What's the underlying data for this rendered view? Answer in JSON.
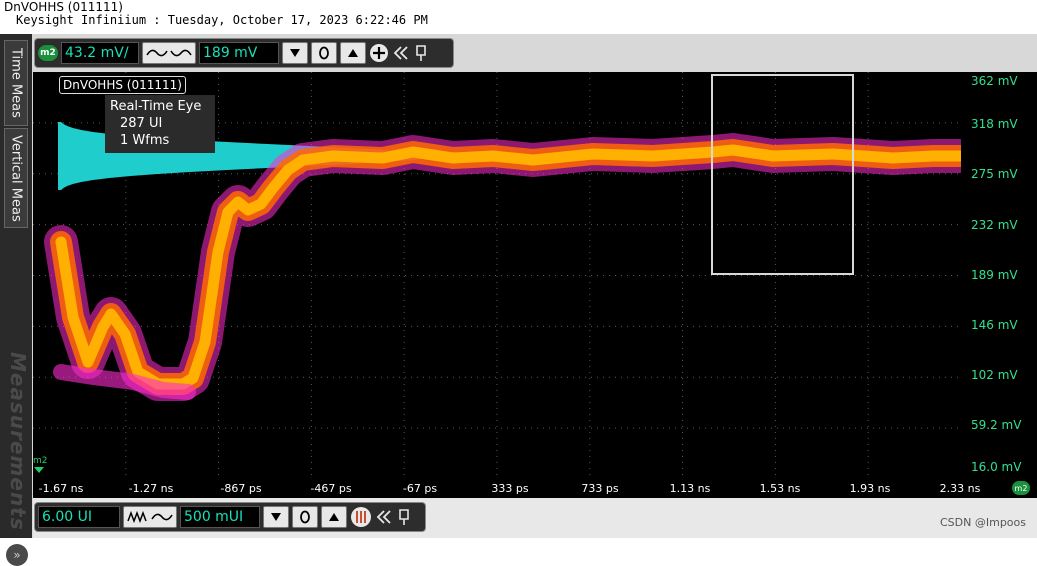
{
  "window": {
    "title": "DnVOHHS (011111)",
    "subtitle": "Keysight Infiniium : Tuesday, October 17, 2023 6:22:46 PM"
  },
  "sidebar": {
    "tabs": [
      "Time Meas",
      "Vertical Meas"
    ],
    "panel_label": "Measurements",
    "expand_glyph": "»"
  },
  "vertical_control": {
    "badge": "m2",
    "scale": "43.2 mV/",
    "offset": "189 mV"
  },
  "horizontal_control": {
    "scale": "6.00 UI",
    "position": "500 mUI"
  },
  "waveform": {
    "label": "DnVOHHS (011111)",
    "mode": "Real-Time Eye",
    "ui_count": "287 UI",
    "wfm_count": "1 Wfms"
  },
  "y_axis_labels": [
    "362 mV",
    "318 mV",
    "275 mV",
    "232 mV",
    "189 mV",
    "146 mV",
    "102 mV",
    "59.2 mV",
    "16.0 mV"
  ],
  "x_axis_labels": [
    "-1.67 ns",
    "-1.27 ns",
    "-867 ps",
    "-467 ps",
    "-67 ps",
    "333 ps",
    "733 ps",
    "1.13 ns",
    "1.53 ns",
    "1.93 ns",
    "2.33 ns"
  ],
  "marker_label": "m2",
  "watermark": "CSDN @Impoos",
  "colors": {
    "trace_core": "#ffb000",
    "trace_mid": "#ff6a00",
    "trace_outer": "#ff2bd0",
    "histogram": "#22d8d8",
    "axis_text": "#33e08f",
    "mask": "#d8d8d8"
  }
}
